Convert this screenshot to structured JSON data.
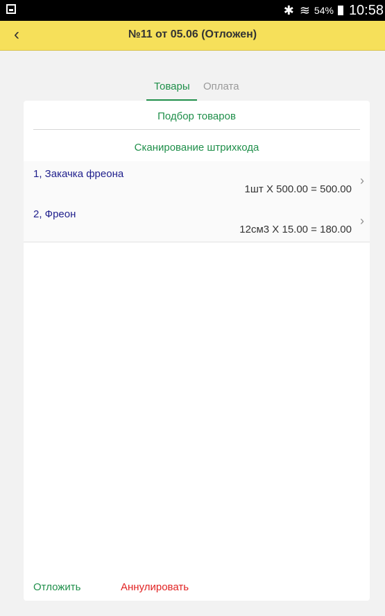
{
  "status_bar": {
    "battery": "54%",
    "time": "10:58"
  },
  "header": {
    "title": "№11 от 05.06 (Отложен)"
  },
  "tabs": {
    "active": "Товары",
    "inactive": "Оплата"
  },
  "actions": {
    "select_goods": "Подбор товаров",
    "scan_barcode": "Сканирование штрихкода"
  },
  "items": [
    {
      "title": "1, Закачка фреона",
      "detail": "1шт X 500.00 = 500.00"
    },
    {
      "title": "2, Фреон",
      "detail": "12см3 X 15.00 = 180.00"
    }
  ],
  "footer": {
    "postpone": "Отложить",
    "cancel": "Аннулировать"
  }
}
